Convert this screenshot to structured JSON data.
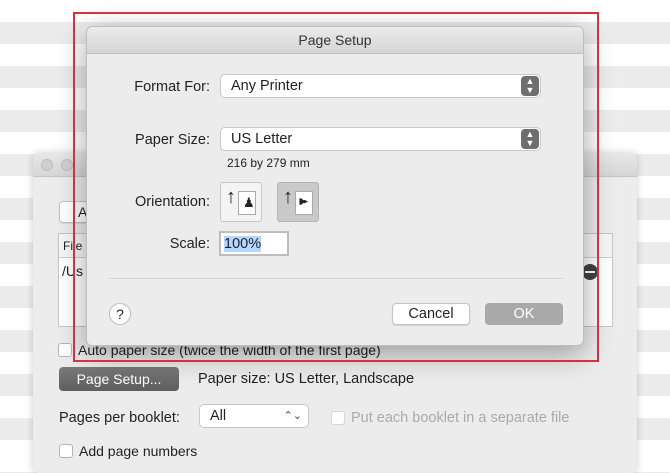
{
  "dialog": {
    "title": "Page Setup",
    "format_for_label": "Format For:",
    "format_for_value": "Any Printer",
    "paper_size_label": "Paper Size:",
    "paper_size_value": "US Letter",
    "paper_dimensions": "216 by 279 mm",
    "orientation_label": "Orientation:",
    "orientation_selected": "landscape",
    "scale_label": "Scale:",
    "scale_value": "100%",
    "help": "?",
    "cancel": "Cancel",
    "ok": "OK"
  },
  "background_window": {
    "button_partial": "A",
    "file_column_partial": "File",
    "file_row_partial": "/Us",
    "auto_paper_size": "Auto paper size (twice the width of the first page)",
    "page_setup_button": "Page Setup...",
    "paper_size_info": "Paper size: US Letter, Landscape",
    "pages_per_booklet_label": "Pages per booklet:",
    "pages_per_booklet_value": "All",
    "separate_file": "Put each booklet in a separate file",
    "add_page_numbers": "Add page numbers"
  },
  "colors": {
    "highlight": "#d9303e",
    "selection": "#b3d7ff"
  }
}
